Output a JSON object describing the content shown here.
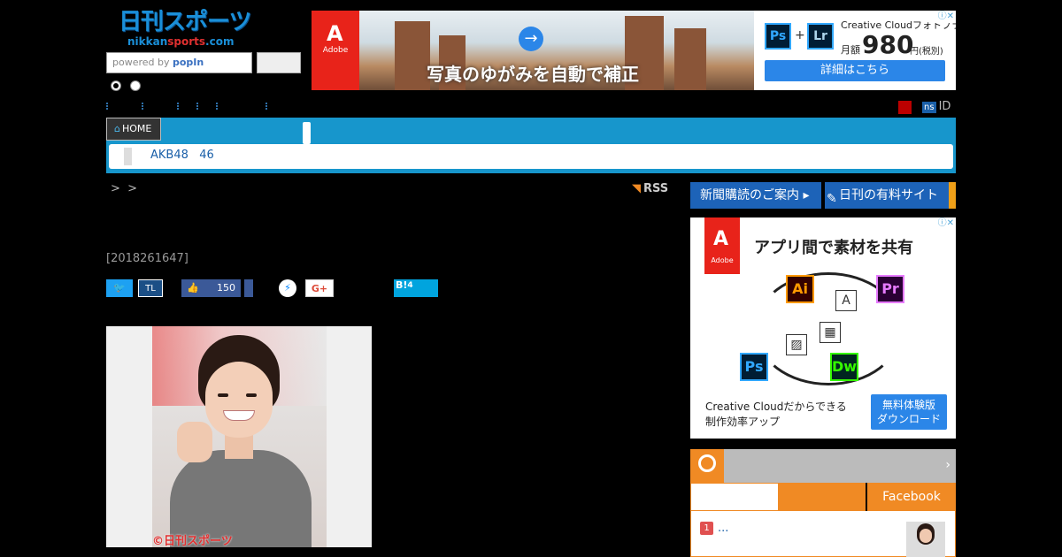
{
  "header": {
    "logo_jp": "日刊スポーツ",
    "logo_en_a": "nikkan",
    "logo_en_b": "sports",
    "logo_en_c": ".com",
    "search_placeholder_prefix": "powered by ",
    "search_placeholder_brand": "popIn",
    "ns_badge": "ns",
    "id_label": "ID"
  },
  "ad_top": {
    "brand": "Adobe",
    "headline": "写真のゆがみを自動で補正",
    "product_line": "Creative Cloudフォトプラン",
    "ps": "Ps",
    "plus": "+",
    "lr": "Lr",
    "price_label": "月額",
    "price": "980",
    "price_unit": "円(税別)",
    "cta": "詳細はこちら",
    "adchoice": "ⓘ✕"
  },
  "nav": {
    "home": "HOME",
    "sub_label": "AKB48   46"
  },
  "breadcrumb": ">  >",
  "rss": "RSS",
  "article": {
    "timestamp": "[2018261647]",
    "photo_credit": "©日刊スポーツ"
  },
  "social": {
    "tw": "🐦",
    "tl": "TL",
    "fb_count": "150",
    "gplus": "G+",
    "hatena": "B!",
    "hatena_count": "4"
  },
  "sidebar": {
    "subscribe": "新聞購読のご案内",
    "paid_site": "日刊の有料サイト",
    "ad": {
      "brand": "Adobe",
      "title": "アプリ間で素材を共有",
      "ai": "Ai",
      "pr": "Pr",
      "ps": "Ps",
      "dw": "Dw",
      "text_line1": "Creative Cloudだからできる",
      "text_line2": "制作効率アップ",
      "cta_line1": "無料体験版",
      "cta_line2": "ダウンロード"
    },
    "ranking_chevron": "›",
    "facebook_tab": "Facebook",
    "rank1_num": "1",
    "rank1_text": "..."
  }
}
